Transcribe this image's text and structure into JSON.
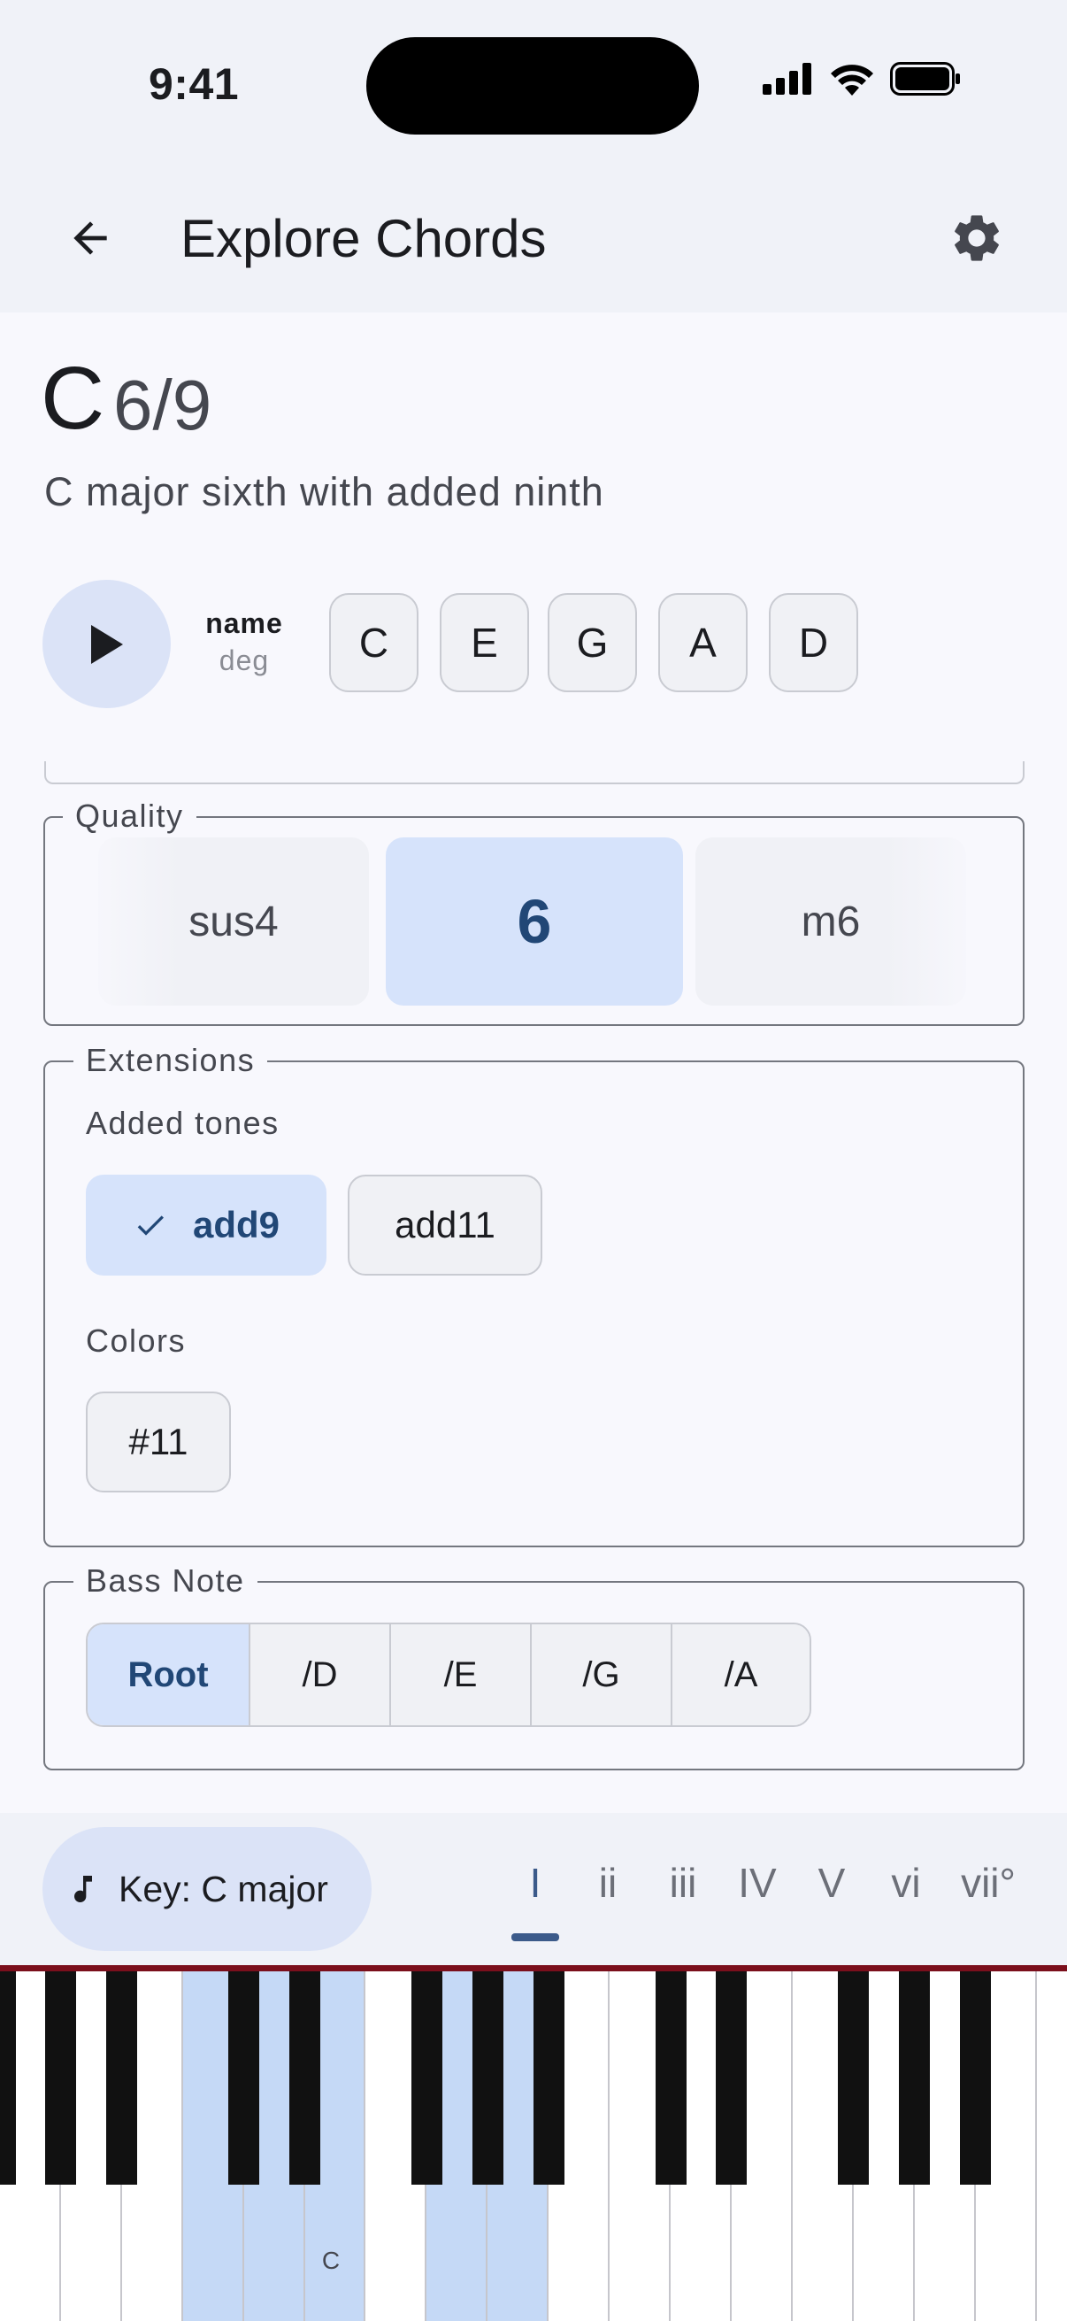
{
  "status_bar": {
    "time": "9:41"
  },
  "app_bar": {
    "title": "Explore Chords",
    "back_icon": "arrow-left-icon",
    "settings_icon": "gear-icon"
  },
  "chord": {
    "root": "C",
    "suffix": "6/9",
    "description": "C major sixth with added ninth",
    "label_name": "name",
    "label_deg": "deg",
    "notes": [
      "C",
      "E",
      "G",
      "A",
      "D"
    ]
  },
  "quality": {
    "legend": "Quality",
    "options": [
      "sus4",
      "6",
      "m6"
    ],
    "selected": "6"
  },
  "extensions": {
    "legend": "Extensions",
    "added_tones_label": "Added tones",
    "added_tones": [
      "add9",
      "add11"
    ],
    "added_selected": "add9",
    "colors_label": "Colors",
    "colors": [
      "#11"
    ]
  },
  "bass": {
    "legend": "Bass Note",
    "options": [
      "Root",
      "/D",
      "/E",
      "/G",
      "/A"
    ],
    "selected": "Root"
  },
  "bottom_bar": {
    "key_label": "Key: C major",
    "degrees": [
      "I",
      "ii",
      "iii",
      "IV",
      "V",
      "vi",
      "vii°"
    ],
    "active_degree": "I"
  },
  "piano": {
    "highlighted_notes": [
      "C",
      "D",
      "E",
      "G",
      "A"
    ],
    "c_label": "C",
    "colors": {
      "highlight": "#c5d9f6",
      "rail": "#7b0f1c"
    }
  },
  "colors": {
    "accent": "#d6e3fb",
    "accent_text": "#214776",
    "surface": "#f8f8fd"
  }
}
